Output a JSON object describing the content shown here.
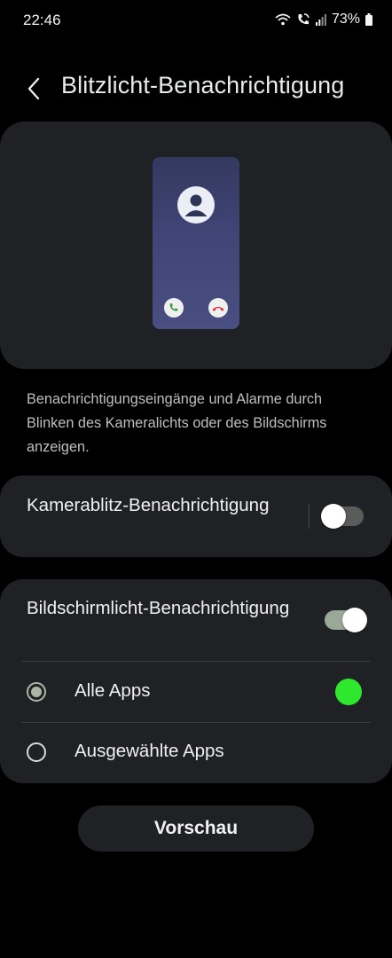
{
  "status_bar": {
    "time": "22:46",
    "battery": "73%",
    "icons": [
      "wifi-icon",
      "wifi-call-icon",
      "signal-icon",
      "battery-icon"
    ]
  },
  "header": {
    "title": "Blitzlicht-Benachrichtigung",
    "back_icon": "chevron-left-icon"
  },
  "preview_illustration": {
    "icons": [
      "avatar-icon",
      "call-accept-icon",
      "call-decline-icon"
    ]
  },
  "description": "Benachrichtigungseingänge und Alarme durch Blinken des Kameralichts oder des Bildschirms anzeigen.",
  "camera_flash": {
    "label": "Kamerablitz-Benachrichtigung",
    "enabled": false
  },
  "screen_flash": {
    "label": "Bildschirmlicht-Benachrichtigung",
    "enabled": true,
    "options": [
      {
        "label": "Alle Apps",
        "selected": true,
        "color": "#2ee82e"
      },
      {
        "label": "Ausgewählte Apps",
        "selected": false
      }
    ]
  },
  "preview_button": {
    "label": "Vorschau"
  },
  "colors": {
    "background": "#000000",
    "card": "#202125",
    "toggle_on": "#9aa898",
    "toggle_off": "#5a5c5a",
    "highlight_color": "#2ee82e"
  }
}
